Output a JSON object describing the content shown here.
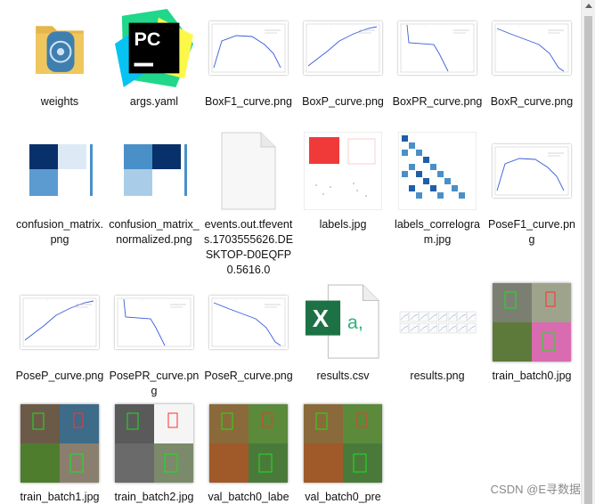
{
  "files": [
    {
      "name": "weights",
      "icon": "folder-icon"
    },
    {
      "name": "args.yaml",
      "icon": "pycharm-icon"
    },
    {
      "name": "BoxF1_curve.png",
      "icon": "chart-thumbnail-icon",
      "plot": "f1"
    },
    {
      "name": "BoxP_curve.png",
      "icon": "chart-thumbnail-icon",
      "plot": "p"
    },
    {
      "name": "BoxPR_curve.png",
      "icon": "chart-thumbnail-icon",
      "plot": "pr"
    },
    {
      "name": "BoxR_curve.png",
      "icon": "chart-thumbnail-icon",
      "plot": "r"
    },
    {
      "name": "confusion_matrix.png",
      "icon": "confusion-matrix-thumbnail-icon",
      "plot": "cm"
    },
    {
      "name": "confusion_matrix_normalized.png",
      "icon": "confusion-matrix-thumbnail-icon",
      "plot": "cmn"
    },
    {
      "name": "events.out.tfevents.1703555626.DESKTOP-D0EQFP0.5616.0",
      "icon": "blank-file-icon"
    },
    {
      "name": "labels.jpg",
      "icon": "labels-thumbnail-icon"
    },
    {
      "name": "labels_correlogram.jpg",
      "icon": "correlogram-thumbnail-icon"
    },
    {
      "name": "PoseF1_curve.png",
      "icon": "chart-thumbnail-icon",
      "plot": "f1"
    },
    {
      "name": "PoseP_curve.png",
      "icon": "chart-thumbnail-icon",
      "plot": "p"
    },
    {
      "name": "PosePR_curve.png",
      "icon": "chart-thumbnail-icon",
      "plot": "pr"
    },
    {
      "name": "PoseR_curve.png",
      "icon": "chart-thumbnail-icon",
      "plot": "r"
    },
    {
      "name": "results.csv",
      "icon": "excel-icon"
    },
    {
      "name": "results.png",
      "icon": "results-thumbnail-icon"
    },
    {
      "name": "train_batch0.jpg",
      "icon": "photo-thumbnail-icon",
      "photo": "a"
    },
    {
      "name": "train_batch1.jpg",
      "icon": "photo-thumbnail-icon",
      "photo": "b"
    },
    {
      "name": "train_batch2.jpg",
      "icon": "photo-thumbnail-icon",
      "photo": "c"
    },
    {
      "name": "val_batch0_labe",
      "icon": "photo-thumbnail-icon",
      "photo": "d"
    },
    {
      "name": "val_batch0_pre",
      "icon": "photo-thumbnail-icon",
      "photo": "d"
    }
  ],
  "watermark": "CSDN @E寻数据",
  "colors": {
    "folder": "#f0c75e",
    "pycharm_green": "#21d789",
    "pycharm_yellow": "#fcf84a",
    "excel_green": "#1d7245",
    "plot_line": "#3b5bdb",
    "matrix_dark": "#08306b",
    "matrix_mid": "#4a90c8"
  }
}
